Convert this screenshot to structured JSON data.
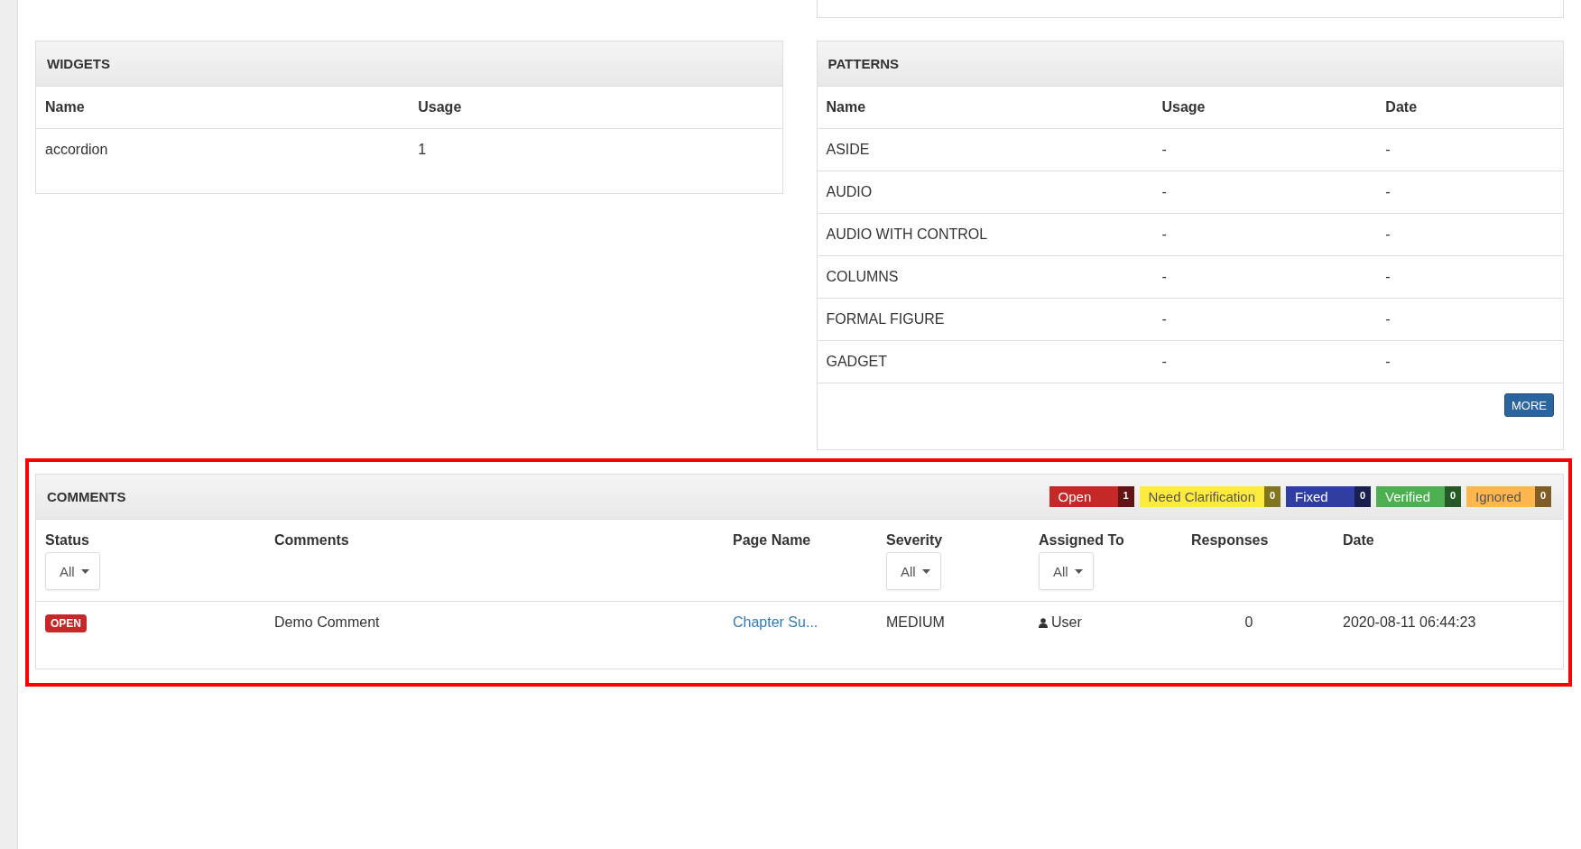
{
  "widgets": {
    "title": "WIDGETS",
    "columns": [
      "Name",
      "Usage"
    ],
    "rows": [
      [
        "accordion",
        "1"
      ]
    ]
  },
  "patterns": {
    "title": "PATTERNS",
    "columns": [
      "Name",
      "Usage",
      "Date"
    ],
    "rows": [
      [
        "ASIDE",
        "-",
        "-"
      ],
      [
        "AUDIO",
        "-",
        "-"
      ],
      [
        "AUDIO WITH CONTROL",
        "-",
        "-"
      ],
      [
        "COLUMNS",
        "-",
        "-"
      ],
      [
        "FORMAL FIGURE",
        "-",
        "-"
      ],
      [
        "GADGET",
        "-",
        "-"
      ]
    ],
    "more_button": "MORE"
  },
  "comments": {
    "title": "COMMENTS",
    "highlighted": true,
    "status_counts": [
      {
        "label": "Open",
        "count": "1",
        "color": "#c62828"
      },
      {
        "label": "Need Clarification",
        "count": "0",
        "color": "#ffeb3b"
      },
      {
        "label": "Fixed",
        "count": "0",
        "color": "#303f9f"
      },
      {
        "label": "Verified",
        "count": "0",
        "color": "#4caf50"
      },
      {
        "label": "Ignored",
        "count": "0",
        "color": "#ffb74d"
      }
    ],
    "columns": [
      {
        "label": "Status",
        "filter": "All"
      },
      {
        "label": "Comments"
      },
      {
        "label": "Page Name"
      },
      {
        "label": "Severity",
        "filter": "All"
      },
      {
        "label": "Assigned To",
        "filter": "All"
      },
      {
        "label": "Responses"
      },
      {
        "label": "Date"
      }
    ],
    "rows": [
      {
        "status": {
          "label": "OPEN",
          "color": "#c62828"
        },
        "comment": "Demo Comment",
        "page_name": "Chapter Su...",
        "severity": "MEDIUM",
        "assigned_to": "User",
        "responses": "0",
        "date": "2020-08-11 06:44:23"
      }
    ]
  }
}
